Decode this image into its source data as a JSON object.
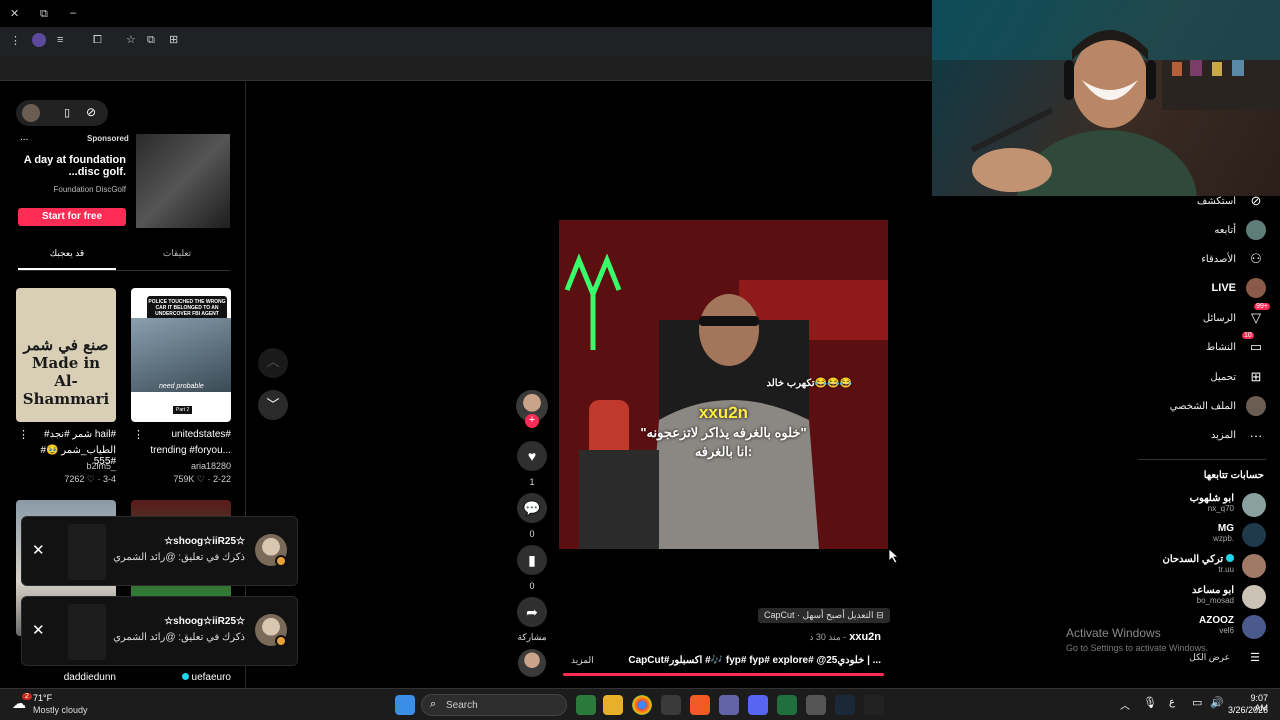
{
  "browser": {
    "window_controls": [
      "–",
      "⧉",
      "×"
    ]
  },
  "sidebar_left": {
    "ad": {
      "label_more": "...",
      "sponsored": "Sponsored",
      "title": "A day at foundation disc golf.",
      "title_line1": "A day at foundation",
      "title_line2": "...disc golf.",
      "advertiser": "Foundation DiscGolf",
      "cta": "Start for free"
    },
    "tabs": [
      {
        "label": "قد يعجبك"
      },
      {
        "label": "تعليقات"
      }
    ],
    "videos": [
      {
        "thumb_text": "صنع في شمر Made in Al-Shammari",
        "caption_line1": "#شمر #نجد hail#",
        "caption_line2": "#الطياب_شمر 🥹 #555",
        "user": "b2lm5_",
        "likes": "7262",
        "age": "3-4"
      },
      {
        "thumb_text": "POLICE TOUCHED THE WRONG CAR IT BELONGED TO AN UNDERCOVER FBI AGENT",
        "thumb_sub": "need probable",
        "thumb_part": "Part 2",
        "caption_line1": "unitedstates#",
        "caption_line2": "trending #foryou...",
        "user": "aria18280",
        "likes": "759K",
        "age": "2-22"
      },
      {
        "user": "daddiedunn"
      },
      {
        "user": "uefaeuro"
      }
    ]
  },
  "notifications": [
    {
      "name": "☆shoog☆iiR25☆",
      "text": "ذكرك في تعليق: @رائد الشمري"
    },
    {
      "name": "☆shoog☆iiR25☆",
      "text": "ذكرك في تعليق: @رائد الشمري"
    }
  ],
  "video": {
    "overlay_top": "تكهرب خالد😂😂😂",
    "overlay_handle": "xxu2n",
    "overlay_quote1": "\"خلوه بالغرفه يذاكر لاتزعجونه\"",
    "overlay_quote2": "انا بالغرفه:",
    "actions": {
      "likes": "1",
      "comments": "0",
      "saves": "0",
      "share_label": "مشاركة"
    },
    "capcut_label": "CapCut · التعديل أصبح أسهل",
    "author": "xxu2n",
    "age": "منذ 30 د -",
    "description": "CapCut#اكسبلور #🎶 fyp# fyp# explore# @خلودي25 | ...",
    "more": "المزيد"
  },
  "nav_right": {
    "items": [
      {
        "label": "استكشف",
        "icon": "compass-icon"
      },
      {
        "label": "أتابعه",
        "icon": "avatar"
      },
      {
        "label": "الأصدقاء",
        "icon": "friends-icon"
      },
      {
        "label": "LIVE",
        "icon": "live-avatar"
      },
      {
        "label": "الرسائل",
        "icon": "inbox-icon",
        "badge": "99+"
      },
      {
        "label": "النشاط",
        "icon": "messages-icon",
        "badge": "10"
      },
      {
        "label": "تحميل",
        "icon": "upload-icon"
      },
      {
        "label": "الملف الشخصي",
        "icon": "profile-avatar"
      },
      {
        "label": "المزيد",
        "icon": "more-icon"
      }
    ],
    "following_title": "حسابات تتابعها",
    "following": [
      {
        "name": "ابو شلهوب",
        "handle": "nx_q70"
      },
      {
        "name": "MG",
        "handle": "wzpb."
      },
      {
        "name": "تركي السدحان",
        "handle": "tr.uu",
        "verified": true
      },
      {
        "name": "ابو مساعد",
        "handle": "bo_mosad"
      },
      {
        "name": "AZOOZ",
        "handle": "vel6"
      }
    ],
    "see_all": "عرض الكل"
  },
  "activation": {
    "title": "Activate Windows",
    "subtitle": "Go to Settings to activate Windows."
  },
  "taskbar": {
    "weather_temp": "71°F",
    "weather_desc": "Mostly cloudy",
    "weather_badge": "2",
    "search_placeholder": "Search",
    "time": "9:07 AM",
    "date": "3/26/2026",
    "lang": "ع"
  },
  "colors": {
    "accent": "#fe2c55",
    "bg": "#000000"
  }
}
